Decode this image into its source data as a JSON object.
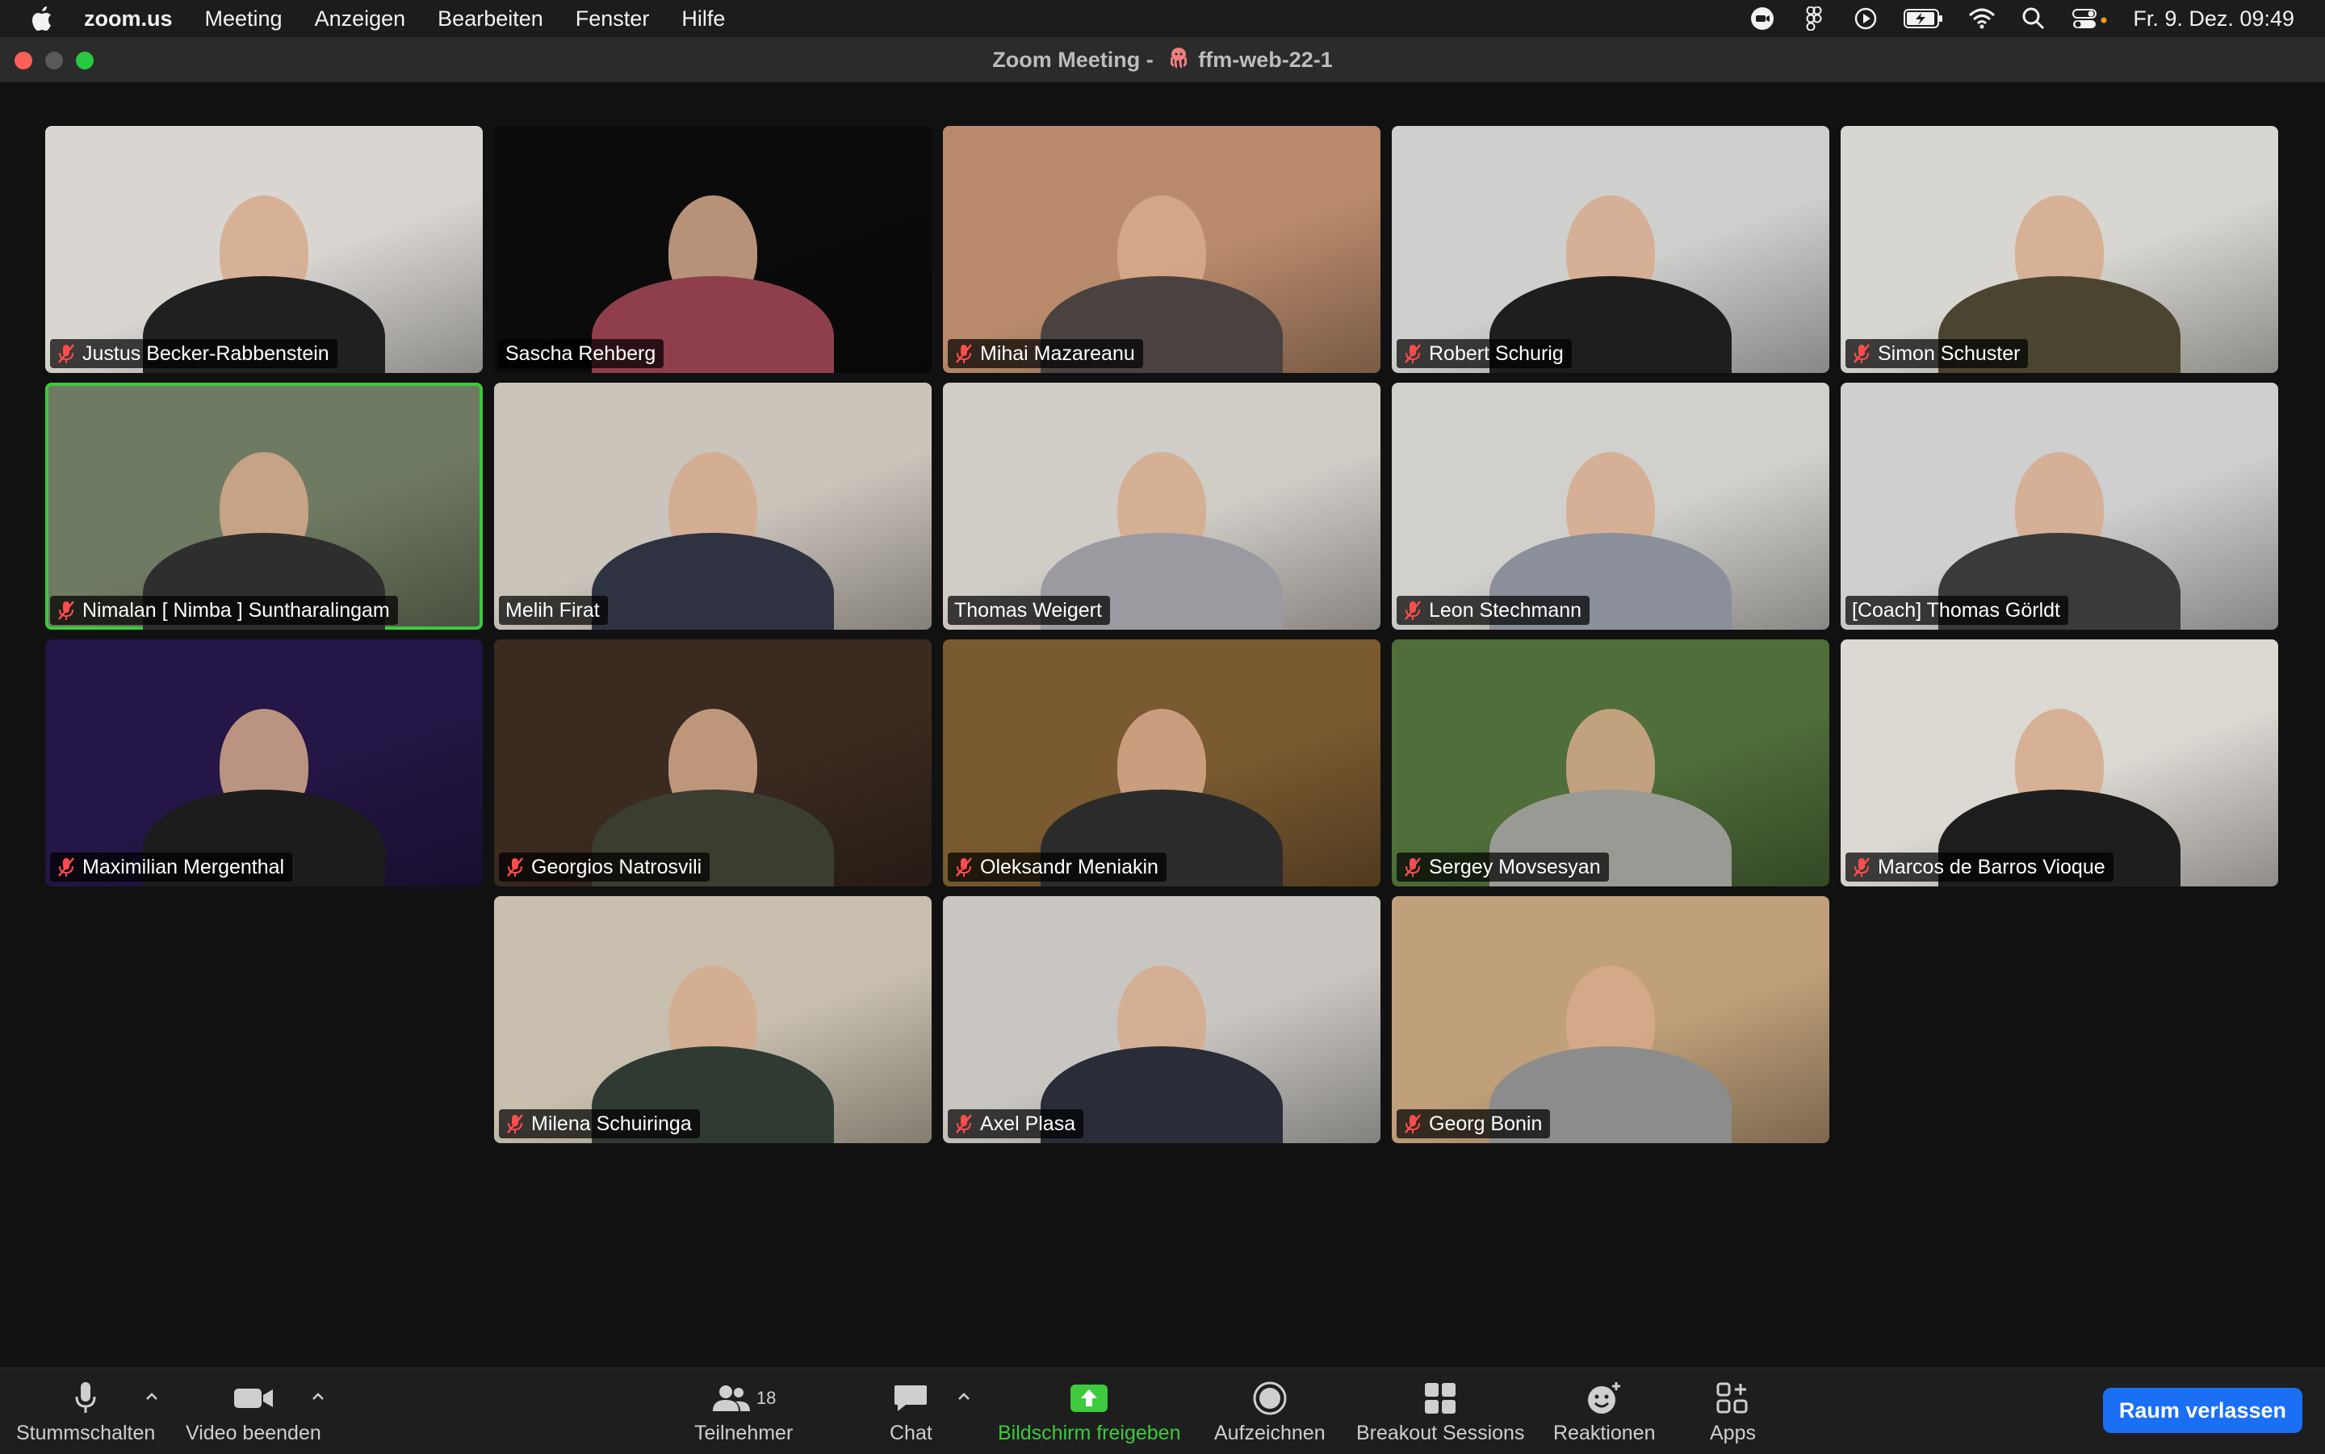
{
  "menubar": {
    "app": "zoom.us",
    "items": [
      "Meeting",
      "Anzeigen",
      "Bearbeiten",
      "Fenster",
      "Hilfe"
    ],
    "clock": "Fr. 9. Dez.  09:49"
  },
  "window": {
    "title": "Zoom Meeting - ",
    "meeting_name": "ffm-web-22-1"
  },
  "participants": [
    {
      "name": "Justus Becker-Rabbenstein",
      "muted": true,
      "bg": "#d9d6d2",
      "shirt": "#202020"
    },
    {
      "name": "Sascha Rehberg",
      "muted": false,
      "bg": "#0b0b0b",
      "shirt": "#8f3f4c"
    },
    {
      "name": "Mihai Mazareanu",
      "muted": true,
      "bg": "#b98a6b",
      "shirt": "#4a4240"
    },
    {
      "name": "Robert Schurig",
      "muted": true,
      "bg": "#cfcfcd",
      "shirt": "#1e1e1e"
    },
    {
      "name": "Simon Schuster",
      "muted": true,
      "bg": "#d8d6d0",
      "shirt": "#4b4430"
    },
    {
      "name": "Nimalan [ Nimba ] Suntharalingam",
      "muted": true,
      "bg": "#6f7a62",
      "shirt": "#2e2e2e",
      "active": true
    },
    {
      "name": "Melih Firat",
      "muted": false,
      "bg": "#cac4bb",
      "shirt": "#2f3240"
    },
    {
      "name": "Thomas Weigert",
      "muted": false,
      "bg": "#d0ccc6",
      "shirt": "#9a9aa0"
    },
    {
      "name": "Leon Stechmann",
      "muted": true,
      "bg": "#d2d0cc",
      "shirt": "#8a8f99"
    },
    {
      "name": "[Coach] Thomas Görldt",
      "muted": false,
      "bg": "#cfcfcf",
      "shirt": "#3a3a3a"
    },
    {
      "name": "Maximilian Mergenthal",
      "muted": true,
      "bg": "#241646",
      "shirt": "#1c1c1c"
    },
    {
      "name": "Georgios Natrosvili",
      "muted": true,
      "bg": "#3a2a20",
      "shirt": "#3b3d30"
    },
    {
      "name": "Oleksandr Meniakin",
      "muted": true,
      "bg": "#7a5a30",
      "shirt": "#2b2b2b"
    },
    {
      "name": "Sergey Movsesyan",
      "muted": true,
      "bg": "#4f6e3a",
      "shirt": "#9a9a95"
    },
    {
      "name": "Marcos de Barros Vioque",
      "muted": true,
      "bg": "#dcd8d2",
      "shirt": "#1e1e1e"
    },
    {
      "name": "Milena Schuiringa",
      "muted": true,
      "bg": "#c8bfae",
      "shirt": "#2f3a33"
    },
    {
      "name": "Axel Plasa",
      "muted": true,
      "bg": "#c9c6c2",
      "shirt": "#2a2d38"
    },
    {
      "name": "Georg Bonin",
      "muted": true,
      "bg": "#bfa07a",
      "shirt": "#8c8c8c"
    }
  ],
  "toolbar": {
    "mute_label": "Stummschalten",
    "video_label": "Video beenden",
    "participants_label": "Teilnehmer",
    "participants_count": "18",
    "chat_label": "Chat",
    "share_label": "Bildschirm freigeben",
    "record_label": "Aufzeichnen",
    "breakout_label": "Breakout Sessions",
    "reactions_label": "Reaktionen",
    "apps_label": "Apps",
    "leave_label": "Raum verlassen",
    "share_color": "#3ec93e",
    "leave_color": "#1a6ff5"
  }
}
